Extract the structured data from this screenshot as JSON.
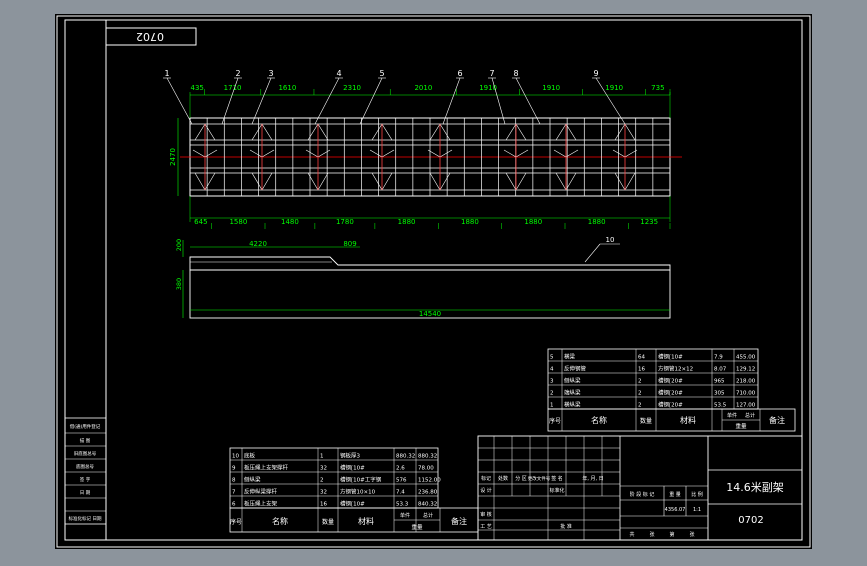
{
  "colors": {
    "bg_outer": "#8c949c",
    "canvas": "#000000",
    "frame": "#ffffff",
    "dim": "#00ff00",
    "structure": "#ffffff",
    "centerline": "#ff0000",
    "bracing": "#ff4040"
  },
  "stamp": "0702",
  "part_labels": [
    "1",
    "2",
    "3",
    "4",
    "5",
    "6",
    "7",
    "8",
    "9"
  ],
  "label_10": "10",
  "top_dims": [
    "435",
    "1710",
    "1610",
    "2310",
    "2010",
    "1910",
    "1910",
    "1910",
    "735"
  ],
  "bottom_dims": [
    "645",
    "1580",
    "1480",
    "1780",
    "1880",
    "1880",
    "1880",
    "1880",
    "1235"
  ],
  "width_dim": "2470",
  "side_dims": {
    "length": "4220",
    "step": "809",
    "h1": "200",
    "h2": "380",
    "total": "14540"
  },
  "parts_list_upper": [
    {
      "no": "5",
      "name": "横梁",
      "qty": "64",
      "material": "槽钢[10#",
      "w1": "7.9",
      "w2": "455.00"
    },
    {
      "no": "4",
      "name": "反伸钢管",
      "qty": "16",
      "material": "方钢管12×12",
      "w1": "8.07",
      "w2": "129.12"
    },
    {
      "no": "3",
      "name": "侧纵梁",
      "qty": "2",
      "material": "槽钢[20#",
      "w1": "965",
      "w2": "218.00"
    },
    {
      "no": "2",
      "name": "端纵梁",
      "qty": "2",
      "material": "槽钢[20#",
      "w1": "305",
      "w2": "710.00"
    },
    {
      "no": "1",
      "name": "横纵梁",
      "qty": "2",
      "material": "槽钢[20#",
      "w1": "53.5",
      "w2": "127.00"
    }
  ],
  "parts_list_lower": [
    {
      "no": "10",
      "name": "底板",
      "qty": "1",
      "material": "钢板厚3",
      "w1": "880.32",
      "w2": "880.32"
    },
    {
      "no": "9",
      "name": "板压绳上支架撑杆",
      "qty": "32",
      "material": "槽钢[10#",
      "w1": "2.6",
      "w2": "78.00"
    },
    {
      "no": "8",
      "name": "侧纵梁",
      "qty": "2",
      "material": "槽钢[10#工字钢",
      "w1": "576",
      "w2": "1152.00"
    },
    {
      "no": "7",
      "name": "反伸纵梁撑杆",
      "qty": "32",
      "material": "方钢管10×10",
      "w1": "7.4",
      "w2": "236.80"
    },
    {
      "no": "6",
      "name": "板压绳上支架",
      "qty": "16",
      "material": "槽钢[10#",
      "w1": "53.3",
      "w2": "840.32"
    }
  ],
  "parts_header": {
    "no": "序号",
    "name": "名称",
    "qty": "数量",
    "material": "材料",
    "unit": "单件",
    "total": "总计",
    "weight": "重量",
    "remark": "备注"
  },
  "title_block": {
    "title": "14.6米副架",
    "drawing_no": "0702",
    "row1": [
      "标记",
      "处数",
      "分 区",
      "更改文件号",
      "签 名",
      "年, 月, 日"
    ],
    "row2": [
      "设 计",
      "",
      "",
      "标准化"
    ],
    "row3": [
      "审 核"
    ],
    "row4": [
      "工 艺",
      "",
      "批 准"
    ],
    "stage_cols": [
      "阶 段 标 记",
      "重 量",
      "比 例"
    ],
    "weight_val": "4356.07",
    "scale_val": "1:1",
    "sheet": [
      "共",
      "张",
      "第",
      "张"
    ]
  },
  "left_strip": [
    "借(通)用件登记",
    "描 图",
    "旧底图总号",
    "底图总号",
    "签 字",
    "日 期",
    "标准化标记 日期"
  ]
}
